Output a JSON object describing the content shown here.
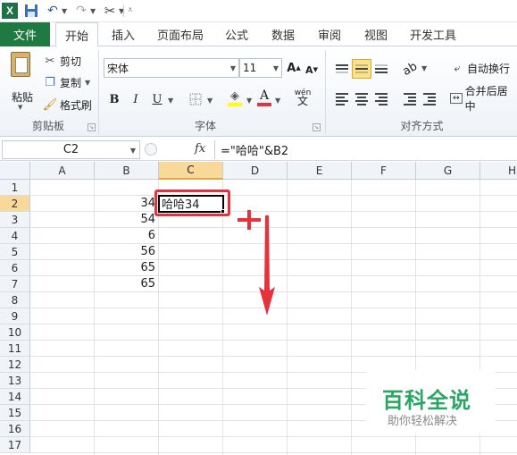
{
  "quick_access": {
    "app_icon": "X"
  },
  "tabs": [
    {
      "label": "文件"
    },
    {
      "label": "开始"
    },
    {
      "label": "插入"
    },
    {
      "label": "页面布局"
    },
    {
      "label": "公式"
    },
    {
      "label": "数据"
    },
    {
      "label": "审阅"
    },
    {
      "label": "视图"
    },
    {
      "label": "开发工具"
    }
  ],
  "clipboard": {
    "paste": "粘贴",
    "cut": "剪切",
    "copy": "复制",
    "format_painter": "格式刷",
    "group": "剪贴板"
  },
  "font": {
    "name": "宋体",
    "size": "11",
    "bold": "B",
    "italic": "I",
    "underline": "U",
    "group": "字体",
    "phonetic": "wén"
  },
  "alignment": {
    "wrap": "自动换行",
    "merge": "合并后居中",
    "group": "对齐方式"
  },
  "formula_bar": {
    "name_box": "C2",
    "fx": "fx",
    "formula": "=\"哈哈\"&B2"
  },
  "columns": [
    "A",
    "B",
    "C",
    "D",
    "E",
    "F",
    "G",
    "H"
  ],
  "rows": [
    "1",
    "2",
    "3",
    "4",
    "5",
    "6",
    "7",
    "8",
    "9",
    "10",
    "11",
    "12",
    "13",
    "14",
    "15",
    "16",
    "17"
  ],
  "cells": {
    "b2": "34",
    "b3": "54",
    "b4": "6",
    "b5": "56",
    "b6": "65",
    "b7": "65",
    "c2": "哈哈34"
  },
  "watermark": {
    "title": "百科全说",
    "subtitle": "助你轻松解决"
  },
  "colors": {
    "excel_green": "#1f7a42",
    "highlight": "#e5323b",
    "selection_header": "#f9d99a"
  }
}
